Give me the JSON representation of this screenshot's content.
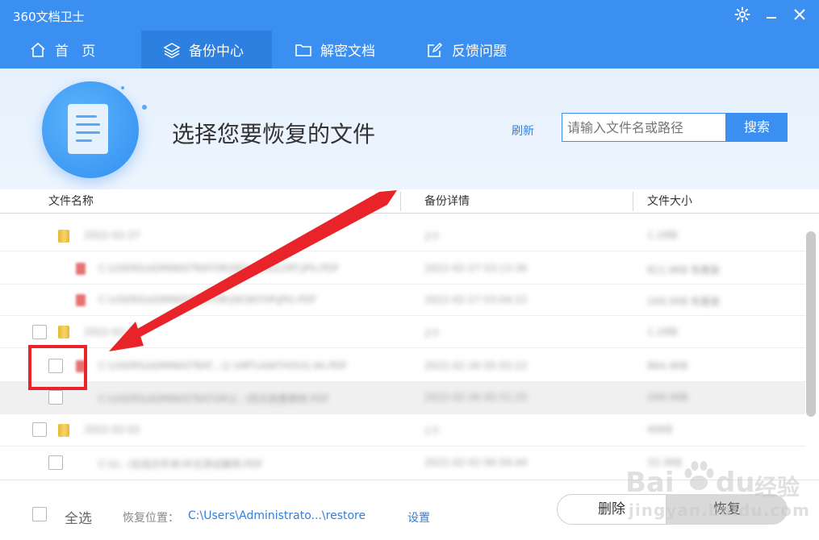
{
  "app": {
    "title": "360文档卫士"
  },
  "window": {
    "settings_icon": "gear-icon",
    "minimize_icon": "minimize-icon",
    "close_icon": "close-icon"
  },
  "nav": {
    "items": [
      {
        "label": "首   页",
        "icon": "home-icon",
        "active": false
      },
      {
        "label": "备份中心",
        "icon": "layers-icon",
        "active": true
      },
      {
        "label": "解密文档",
        "icon": "folder-icon",
        "active": false
      },
      {
        "label": "反馈问题",
        "icon": "edit-icon",
        "active": false
      }
    ]
  },
  "header": {
    "title": "选择您要恢复的文件",
    "refresh": "刷新",
    "search_placeholder": "请输入文件名或路径",
    "search_button": "搜索"
  },
  "table": {
    "columns": [
      "文件名称",
      "备份详情",
      "文件大小"
    ],
    "rows": [
      {
        "kind": "folder",
        "name": "2022-02-27",
        "detail": "2个",
        "size": "1.1MB",
        "checkbox": false
      },
      {
        "kind": "file",
        "name": "C:\\USERS\\ADMINISTRATOR\\DES...\\2022RT.JPG.PDF",
        "detail": "2022-02-27 03:13:36",
        "size": "811.9KB 有重复",
        "checkbox": false
      },
      {
        "kind": "file",
        "name": "C:\\USERS\\ADMINISTRATOR\\DESKTOP\\JPG.PDF",
        "detail": "2022-02-27 03:04:22",
        "size": "249.5KB 有重复",
        "checkbox": false
      },
      {
        "kind": "folder",
        "name": "2022-02-26",
        "detail": "2个",
        "size": "1.1MB",
        "checkbox": true
      },
      {
        "kind": "file",
        "name": "C:\\USERS\\ADMINISTRAT...\\2.VIRTUANTHOUS.9A.PDF",
        "detail": "2022-02-26 05:55:22",
        "size": "864.4KB",
        "checkbox": true
      },
      {
        "kind": "file",
        "name": "C:\\USERS\\ADMINISTRATOR\\2...\\同文放置期待.PDF",
        "detail": "2022-02-26 05:51:25",
        "size": "249.5KB",
        "checkbox": true,
        "highlighted": true
      },
      {
        "kind": "folder",
        "name": "2022-02-02",
        "detail": "1个",
        "size": "40KB",
        "checkbox": true
      },
      {
        "kind": "file",
        "name": "C:\\U...\\在线文件夹\\中文测试案例.PDF",
        "detail": "2022-02-02 06:59:44",
        "size": "33.3KB",
        "checkbox": true
      }
    ]
  },
  "footer": {
    "select_all": "全选",
    "restore_location_label": "恢复位置：",
    "restore_path": "C:\\Users\\Administrato...\\restore",
    "settings": "设置",
    "delete_button": "删除",
    "restore_button": "恢复"
  },
  "watermark": {
    "brand": "Bai",
    "brand2": "du",
    "cn": "经验",
    "url": "jingyan.baidu.com"
  },
  "colors": {
    "accent": "#3b8ff0",
    "nav_active": "#2d7fe0",
    "annotation": "#e8242a"
  }
}
